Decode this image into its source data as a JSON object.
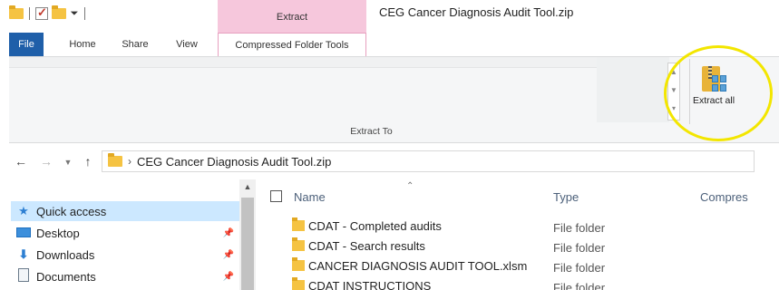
{
  "window": {
    "title": "CEG Cancer Diagnosis Audit Tool.zip",
    "context_tab_header": "Extract"
  },
  "tabs": [
    {
      "label": "File"
    },
    {
      "label": "Home"
    },
    {
      "label": "Share"
    },
    {
      "label": "View"
    },
    {
      "label": "Compressed Folder Tools"
    }
  ],
  "ribbon": {
    "extract_all_label": "Extract all",
    "group_label": "Extract To"
  },
  "address": {
    "path": "CEG Cancer Diagnosis Audit Tool.zip"
  },
  "nav": {
    "items": [
      {
        "label": "Quick access",
        "icon": "star-icon"
      },
      {
        "label": "Desktop",
        "icon": "desktop-icon",
        "pinned": true
      },
      {
        "label": "Downloads",
        "icon": "download-icon",
        "pinned": true
      },
      {
        "label": "Documents",
        "icon": "document-icon",
        "pinned": true
      }
    ]
  },
  "files": {
    "columns": [
      "Name",
      "Type",
      "Compres"
    ],
    "rows": [
      {
        "name": "CDAT - Completed audits",
        "type": "File folder"
      },
      {
        "name": "CDAT - Search results",
        "type": "File folder"
      },
      {
        "name": "CANCER DIAGNOSIS AUDIT TOOL.xlsm",
        "type": "File folder"
      },
      {
        "name": "CDAT INSTRUCTIONS",
        "type": "File folder"
      }
    ]
  },
  "colors": {
    "file_tab": "#1f5fa9",
    "context_tab": "#f6c7dc",
    "highlight_circle": "#f3e600",
    "selection": "#cce8ff"
  }
}
